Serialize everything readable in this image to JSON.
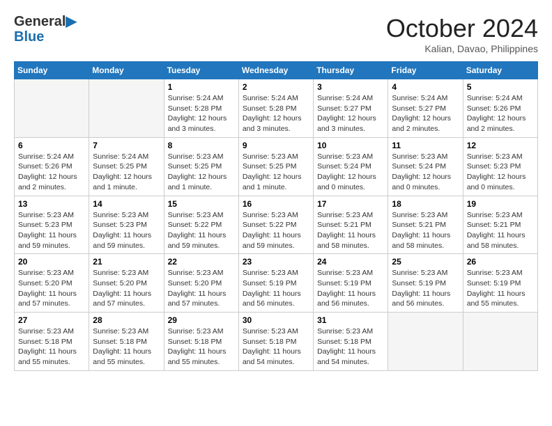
{
  "header": {
    "logo_line1": "General",
    "logo_line2": "Blue",
    "month": "October 2024",
    "location": "Kalian, Davao, Philippines"
  },
  "weekdays": [
    "Sunday",
    "Monday",
    "Tuesday",
    "Wednesday",
    "Thursday",
    "Friday",
    "Saturday"
  ],
  "weeks": [
    [
      {
        "day": "",
        "info": ""
      },
      {
        "day": "",
        "info": ""
      },
      {
        "day": "1",
        "info": "Sunrise: 5:24 AM\nSunset: 5:28 PM\nDaylight: 12 hours\nand 3 minutes."
      },
      {
        "day": "2",
        "info": "Sunrise: 5:24 AM\nSunset: 5:28 PM\nDaylight: 12 hours\nand 3 minutes."
      },
      {
        "day": "3",
        "info": "Sunrise: 5:24 AM\nSunset: 5:27 PM\nDaylight: 12 hours\nand 3 minutes."
      },
      {
        "day": "4",
        "info": "Sunrise: 5:24 AM\nSunset: 5:27 PM\nDaylight: 12 hours\nand 2 minutes."
      },
      {
        "day": "5",
        "info": "Sunrise: 5:24 AM\nSunset: 5:26 PM\nDaylight: 12 hours\nand 2 minutes."
      }
    ],
    [
      {
        "day": "6",
        "info": "Sunrise: 5:24 AM\nSunset: 5:26 PM\nDaylight: 12 hours\nand 2 minutes."
      },
      {
        "day": "7",
        "info": "Sunrise: 5:24 AM\nSunset: 5:25 PM\nDaylight: 12 hours\nand 1 minute."
      },
      {
        "day": "8",
        "info": "Sunrise: 5:23 AM\nSunset: 5:25 PM\nDaylight: 12 hours\nand 1 minute."
      },
      {
        "day": "9",
        "info": "Sunrise: 5:23 AM\nSunset: 5:25 PM\nDaylight: 12 hours\nand 1 minute."
      },
      {
        "day": "10",
        "info": "Sunrise: 5:23 AM\nSunset: 5:24 PM\nDaylight: 12 hours\nand 0 minutes."
      },
      {
        "day": "11",
        "info": "Sunrise: 5:23 AM\nSunset: 5:24 PM\nDaylight: 12 hours\nand 0 minutes."
      },
      {
        "day": "12",
        "info": "Sunrise: 5:23 AM\nSunset: 5:23 PM\nDaylight: 12 hours\nand 0 minutes."
      }
    ],
    [
      {
        "day": "13",
        "info": "Sunrise: 5:23 AM\nSunset: 5:23 PM\nDaylight: 11 hours\nand 59 minutes."
      },
      {
        "day": "14",
        "info": "Sunrise: 5:23 AM\nSunset: 5:23 PM\nDaylight: 11 hours\nand 59 minutes."
      },
      {
        "day": "15",
        "info": "Sunrise: 5:23 AM\nSunset: 5:22 PM\nDaylight: 11 hours\nand 59 minutes."
      },
      {
        "day": "16",
        "info": "Sunrise: 5:23 AM\nSunset: 5:22 PM\nDaylight: 11 hours\nand 59 minutes."
      },
      {
        "day": "17",
        "info": "Sunrise: 5:23 AM\nSunset: 5:21 PM\nDaylight: 11 hours\nand 58 minutes."
      },
      {
        "day": "18",
        "info": "Sunrise: 5:23 AM\nSunset: 5:21 PM\nDaylight: 11 hours\nand 58 minutes."
      },
      {
        "day": "19",
        "info": "Sunrise: 5:23 AM\nSunset: 5:21 PM\nDaylight: 11 hours\nand 58 minutes."
      }
    ],
    [
      {
        "day": "20",
        "info": "Sunrise: 5:23 AM\nSunset: 5:20 PM\nDaylight: 11 hours\nand 57 minutes."
      },
      {
        "day": "21",
        "info": "Sunrise: 5:23 AM\nSunset: 5:20 PM\nDaylight: 11 hours\nand 57 minutes."
      },
      {
        "day": "22",
        "info": "Sunrise: 5:23 AM\nSunset: 5:20 PM\nDaylight: 11 hours\nand 57 minutes."
      },
      {
        "day": "23",
        "info": "Sunrise: 5:23 AM\nSunset: 5:19 PM\nDaylight: 11 hours\nand 56 minutes."
      },
      {
        "day": "24",
        "info": "Sunrise: 5:23 AM\nSunset: 5:19 PM\nDaylight: 11 hours\nand 56 minutes."
      },
      {
        "day": "25",
        "info": "Sunrise: 5:23 AM\nSunset: 5:19 PM\nDaylight: 11 hours\nand 56 minutes."
      },
      {
        "day": "26",
        "info": "Sunrise: 5:23 AM\nSunset: 5:19 PM\nDaylight: 11 hours\nand 55 minutes."
      }
    ],
    [
      {
        "day": "27",
        "info": "Sunrise: 5:23 AM\nSunset: 5:18 PM\nDaylight: 11 hours\nand 55 minutes."
      },
      {
        "day": "28",
        "info": "Sunrise: 5:23 AM\nSunset: 5:18 PM\nDaylight: 11 hours\nand 55 minutes."
      },
      {
        "day": "29",
        "info": "Sunrise: 5:23 AM\nSunset: 5:18 PM\nDaylight: 11 hours\nand 55 minutes."
      },
      {
        "day": "30",
        "info": "Sunrise: 5:23 AM\nSunset: 5:18 PM\nDaylight: 11 hours\nand 54 minutes."
      },
      {
        "day": "31",
        "info": "Sunrise: 5:23 AM\nSunset: 5:18 PM\nDaylight: 11 hours\nand 54 minutes."
      },
      {
        "day": "",
        "info": ""
      },
      {
        "day": "",
        "info": ""
      }
    ]
  ]
}
